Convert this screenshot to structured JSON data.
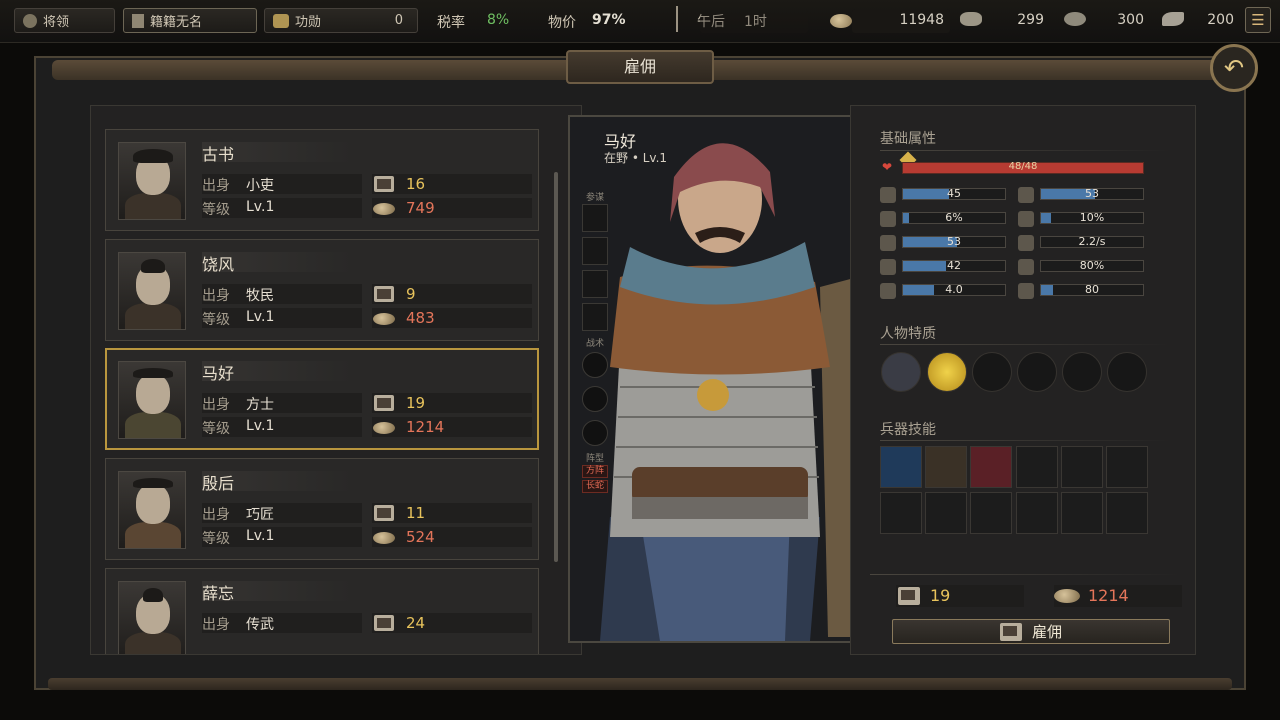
{
  "topbar": {
    "general_label": "将领",
    "name_label": "籍籍无名",
    "merit_label": "功勋",
    "merit_value": "0",
    "tax_label": "税率",
    "tax_value": "8%",
    "price_label": "物价",
    "price_value": "97%",
    "time_label": "午后",
    "time_value": "1时",
    "money": "11948",
    "food": "299",
    "iron": "300",
    "fame": "200"
  },
  "title": "雇佣",
  "list": [
    {
      "name": "古书",
      "origin_label": "出身",
      "origin": "小吏",
      "level_label": "等级",
      "level": "Lv.1",
      "books": "16",
      "cost": "749"
    },
    {
      "name": "饶风",
      "origin_label": "出身",
      "origin": "牧民",
      "level_label": "等级",
      "level": "Lv.1",
      "books": "9",
      "cost": "483"
    },
    {
      "name": "马好",
      "origin_label": "出身",
      "origin": "方士",
      "level_label": "等级",
      "level": "Lv.1",
      "books": "19",
      "cost": "1214"
    },
    {
      "name": "殷后",
      "origin_label": "出身",
      "origin": "巧匠",
      "level_label": "等级",
      "level": "Lv.1",
      "books": "11",
      "cost": "524"
    },
    {
      "name": "薛忘",
      "origin_label": "出身",
      "origin": "传武",
      "books": "24"
    }
  ],
  "character": {
    "name": "马好",
    "subtitle": "在野 • Lv.1",
    "slot_labels": {
      "strategist": "参谋",
      "tactic": "战术",
      "formation": "阵型"
    },
    "formation_tags": [
      "方阵",
      "长蛇"
    ]
  },
  "stats": {
    "section_title": "基础属性",
    "hp": "48/48",
    "hp_fraction": 1.0,
    "rows": [
      {
        "left": "45",
        "left_frac": 0.45,
        "right": "53",
        "right_frac": 0.53
      },
      {
        "left": "6%",
        "left_frac": 0.06,
        "right": "10%",
        "right_frac": 0.1
      },
      {
        "left": "53",
        "left_frac": 0.53,
        "right": "2.2/s",
        "right_frac": 0.0
      },
      {
        "left": "42",
        "left_frac": 0.42,
        "right": "80%",
        "right_frac": 0.0
      },
      {
        "left": "4.0",
        "left_frac": 0.3,
        "right": "80",
        "right_frac": 0.12
      }
    ]
  },
  "traits_title": "人物特质",
  "skills_title": "兵器技能",
  "hire": {
    "books": "19",
    "cost": "1214",
    "button_label": "雇佣"
  },
  "colors": {
    "accent": "#b9963e",
    "cost": "#e4755a",
    "books": "#e8c35c",
    "hp": "#b73b32",
    "stat_bar": "#4a78a8"
  }
}
